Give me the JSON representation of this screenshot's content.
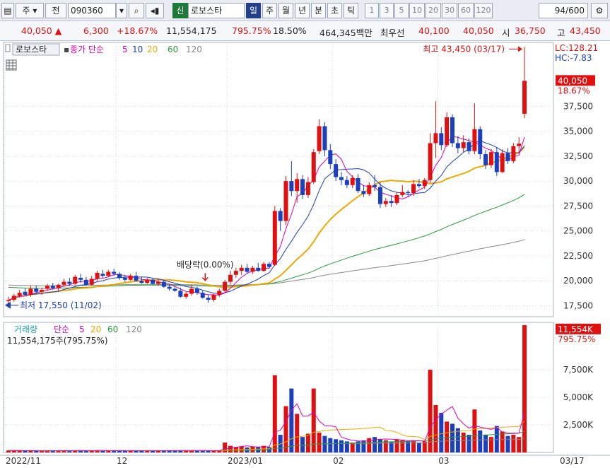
{
  "toolbar": {
    "market": "주",
    "type": "전",
    "code": "090360",
    "market_tag": "신",
    "name": "로보스타",
    "periods": [
      "일",
      "주",
      "월",
      "년",
      "분",
      "초",
      "틱"
    ],
    "active_period": "일",
    "intervals": [
      "1",
      "3",
      "5",
      "10",
      "20",
      "30",
      "60",
      "120"
    ],
    "count": "94/600"
  },
  "info": {
    "price": "40,050",
    "change": "6,300",
    "change_pct": "+18.67%",
    "volume": "11,554,175",
    "volume_ratio": "795.75%",
    "turnover": "18.50%",
    "amount": "464,345백만",
    "best_ask_label": "최우선",
    "best_ask": "40,100",
    "best_bid": "40,050",
    "open_label": "시",
    "open": "36,750",
    "high_label": "고",
    "high": "43,450"
  },
  "colors": {
    "up": "#e01010",
    "down": "#1a3fbf",
    "ma5": "#e000b0",
    "ma10": "#1a3fbf",
    "ma20": "#f0a800",
    "ma60": "#2a9a3a",
    "ma120": "#888888"
  },
  "chart_data": {
    "type": "candlestick",
    "price_panel": {
      "legend": {
        "name": "로보스타",
        "label": "종가 단순",
        "periods": [
          "5",
          "10",
          "20",
          "60",
          "120"
        ]
      },
      "y_ticks": [
        "17,500",
        "20,000",
        "22,500",
        "25,000",
        "27,500",
        "30,000",
        "32,500",
        "35,000",
        "37,500"
      ],
      "ylim": [
        16400,
        43900
      ],
      "lc": "LC:128.21",
      "hc": "HC:-7.83",
      "last_price": "40,050",
      "last_change": "18.67%",
      "high_annotation": "최고 43,450 (03/17)",
      "low_annotation": "최저 17,550 (11/02)",
      "dividend_annotation": "배당락(0.00%)",
      "candles": [
        {
          "o": 17950,
          "h": 18400,
          "l": 17550,
          "c": 18050
        },
        {
          "o": 18100,
          "h": 18700,
          "l": 17900,
          "c": 18500
        },
        {
          "o": 18500,
          "h": 19100,
          "l": 18300,
          "c": 18800
        },
        {
          "o": 18900,
          "h": 19300,
          "l": 18500,
          "c": 18600
        },
        {
          "o": 18600,
          "h": 19500,
          "l": 18400,
          "c": 19200
        },
        {
          "o": 19200,
          "h": 19500,
          "l": 18700,
          "c": 18900
        },
        {
          "o": 18900,
          "h": 19300,
          "l": 18600,
          "c": 19100
        },
        {
          "o": 19200,
          "h": 19700,
          "l": 19000,
          "c": 19500
        },
        {
          "o": 19500,
          "h": 19800,
          "l": 19100,
          "c": 19300
        },
        {
          "o": 19300,
          "h": 19700,
          "l": 18900,
          "c": 19600
        },
        {
          "o": 19600,
          "h": 20200,
          "l": 19400,
          "c": 19900
        },
        {
          "o": 19900,
          "h": 20300,
          "l": 19500,
          "c": 19700
        },
        {
          "o": 19700,
          "h": 20600,
          "l": 19600,
          "c": 20400
        },
        {
          "o": 20300,
          "h": 20700,
          "l": 19800,
          "c": 20100
        },
        {
          "o": 20100,
          "h": 20400,
          "l": 19500,
          "c": 19600
        },
        {
          "o": 19600,
          "h": 20500,
          "l": 19500,
          "c": 20200
        },
        {
          "o": 20200,
          "h": 21000,
          "l": 20000,
          "c": 20800
        },
        {
          "o": 20700,
          "h": 21100,
          "l": 20300,
          "c": 20500
        },
        {
          "o": 20500,
          "h": 21100,
          "l": 20400,
          "c": 20900
        },
        {
          "o": 20900,
          "h": 21200,
          "l": 20500,
          "c": 20700
        },
        {
          "o": 20700,
          "h": 20900,
          "l": 20100,
          "c": 20300
        },
        {
          "o": 20300,
          "h": 20600,
          "l": 19900,
          "c": 20100
        },
        {
          "o": 20100,
          "h": 20700,
          "l": 20000,
          "c": 20500
        },
        {
          "o": 20500,
          "h": 20900,
          "l": 19900,
          "c": 20000
        },
        {
          "o": 20000,
          "h": 20400,
          "l": 19700,
          "c": 19800
        },
        {
          "o": 19800,
          "h": 20300,
          "l": 19700,
          "c": 20100
        },
        {
          "o": 20100,
          "h": 20300,
          "l": 19600,
          "c": 19700
        },
        {
          "o": 19700,
          "h": 20200,
          "l": 19500,
          "c": 19900
        },
        {
          "o": 19900,
          "h": 20100,
          "l": 19300,
          "c": 19400
        },
        {
          "o": 19400,
          "h": 19700,
          "l": 19000,
          "c": 19200
        },
        {
          "o": 19200,
          "h": 19500,
          "l": 18900,
          "c": 19000
        },
        {
          "o": 19000,
          "h": 19300,
          "l": 18300,
          "c": 18400
        },
        {
          "o": 18400,
          "h": 18900,
          "l": 18200,
          "c": 18700
        },
        {
          "o": 18700,
          "h": 19600,
          "l": 18500,
          "c": 19200
        },
        {
          "o": 19200,
          "h": 19400,
          "l": 18600,
          "c": 18800
        },
        {
          "o": 18800,
          "h": 19000,
          "l": 18200,
          "c": 18300
        },
        {
          "o": 18300,
          "h": 18600,
          "l": 17800,
          "c": 18100
        },
        {
          "o": 18100,
          "h": 18700,
          "l": 17900,
          "c": 18600
        },
        {
          "o": 18600,
          "h": 19200,
          "l": 18400,
          "c": 19000
        },
        {
          "o": 19000,
          "h": 20100,
          "l": 18800,
          "c": 19900
        },
        {
          "o": 19900,
          "h": 21000,
          "l": 19600,
          "c": 20600
        },
        {
          "o": 20600,
          "h": 21300,
          "l": 20300,
          "c": 21000
        },
        {
          "o": 21000,
          "h": 21600,
          "l": 20600,
          "c": 21300
        },
        {
          "o": 21300,
          "h": 21700,
          "l": 20700,
          "c": 20900
        },
        {
          "o": 20900,
          "h": 21500,
          "l": 20700,
          "c": 21300
        },
        {
          "o": 21300,
          "h": 21800,
          "l": 20900,
          "c": 21000
        },
        {
          "o": 21000,
          "h": 21900,
          "l": 20900,
          "c": 21700
        },
        {
          "o": 21700,
          "h": 21900,
          "l": 21200,
          "c": 21400
        },
        {
          "o": 21600,
          "h": 27500,
          "l": 21500,
          "c": 27000
        },
        {
          "o": 27000,
          "h": 27300,
          "l": 25000,
          "c": 26000
        },
        {
          "o": 26000,
          "h": 30500,
          "l": 25600,
          "c": 30000
        },
        {
          "o": 30000,
          "h": 32000,
          "l": 28500,
          "c": 29000
        },
        {
          "o": 29000,
          "h": 30800,
          "l": 27800,
          "c": 30200
        },
        {
          "o": 30200,
          "h": 30600,
          "l": 28200,
          "c": 28600
        },
        {
          "o": 28600,
          "h": 30400,
          "l": 28300,
          "c": 29900
        },
        {
          "o": 29900,
          "h": 33200,
          "l": 29700,
          "c": 32900
        },
        {
          "o": 33000,
          "h": 36200,
          "l": 32700,
          "c": 35500
        },
        {
          "o": 35500,
          "h": 35900,
          "l": 32500,
          "c": 33100
        },
        {
          "o": 33100,
          "h": 33700,
          "l": 31200,
          "c": 31700
        },
        {
          "o": 31700,
          "h": 32200,
          "l": 30000,
          "c": 30400
        },
        {
          "o": 30400,
          "h": 30900,
          "l": 29600,
          "c": 30100
        },
        {
          "o": 30100,
          "h": 30500,
          "l": 29300,
          "c": 29600
        },
        {
          "o": 29600,
          "h": 30600,
          "l": 29300,
          "c": 30300
        },
        {
          "o": 30300,
          "h": 30700,
          "l": 28800,
          "c": 29000
        },
        {
          "o": 29000,
          "h": 29600,
          "l": 28400,
          "c": 28700
        },
        {
          "o": 28700,
          "h": 29900,
          "l": 28500,
          "c": 29600
        },
        {
          "o": 29600,
          "h": 30600,
          "l": 29000,
          "c": 29400
        },
        {
          "o": 29400,
          "h": 29900,
          "l": 27300,
          "c": 27700
        },
        {
          "o": 27700,
          "h": 28300,
          "l": 27400,
          "c": 28000
        },
        {
          "o": 28000,
          "h": 28600,
          "l": 27400,
          "c": 27800
        },
        {
          "o": 27800,
          "h": 28900,
          "l": 27600,
          "c": 28600
        },
        {
          "o": 28600,
          "h": 29600,
          "l": 28400,
          "c": 28900
        },
        {
          "o": 28900,
          "h": 29100,
          "l": 28400,
          "c": 28800
        },
        {
          "o": 28800,
          "h": 30100,
          "l": 28500,
          "c": 29700
        },
        {
          "o": 29700,
          "h": 30200,
          "l": 29300,
          "c": 29500
        },
        {
          "o": 29500,
          "h": 30300,
          "l": 29200,
          "c": 30100
        },
        {
          "o": 30100,
          "h": 34800,
          "l": 29800,
          "c": 33800
        },
        {
          "o": 33800,
          "h": 38000,
          "l": 32300,
          "c": 34800
        },
        {
          "o": 34800,
          "h": 35400,
          "l": 33100,
          "c": 33600
        },
        {
          "o": 33600,
          "h": 36900,
          "l": 33400,
          "c": 36400
        },
        {
          "o": 36400,
          "h": 36700,
          "l": 33400,
          "c": 33800
        },
        {
          "o": 33800,
          "h": 34500,
          "l": 32800,
          "c": 33300
        },
        {
          "o": 33300,
          "h": 34600,
          "l": 32900,
          "c": 33900
        },
        {
          "o": 33900,
          "h": 34300,
          "l": 32700,
          "c": 33000
        },
        {
          "o": 33000,
          "h": 37800,
          "l": 32700,
          "c": 35200
        },
        {
          "o": 35200,
          "h": 35500,
          "l": 32200,
          "c": 32700
        },
        {
          "o": 32700,
          "h": 33100,
          "l": 31200,
          "c": 31600
        },
        {
          "o": 31600,
          "h": 33200,
          "l": 31300,
          "c": 32900
        },
        {
          "o": 32900,
          "h": 33400,
          "l": 30500,
          "c": 30900
        },
        {
          "o": 30900,
          "h": 33200,
          "l": 30800,
          "c": 32800
        },
        {
          "o": 32800,
          "h": 33300,
          "l": 31700,
          "c": 32000
        },
        {
          "o": 32000,
          "h": 33800,
          "l": 31800,
          "c": 33500
        },
        {
          "o": 33500,
          "h": 34400,
          "l": 32800,
          "c": 33750
        },
        {
          "o": 36750,
          "h": 43450,
          "l": 36300,
          "c": 40050
        }
      ]
    },
    "volume_panel": {
      "legend": {
        "label": "거래량",
        "method": "단순",
        "periods": [
          "5",
          "20",
          "60",
          "120"
        ]
      },
      "subtitle": "11,554,175주(795.75%)",
      "y_ticks": [
        "2,500K",
        "5,000K",
        "7,500K"
      ],
      "ylim": [
        0,
        11800
      ],
      "last_volume": "11,554K",
      "last_ratio": "795.75%",
      "values": [
        180,
        150,
        170,
        140,
        160,
        150,
        130,
        170,
        150,
        160,
        180,
        140,
        190,
        170,
        160,
        150,
        200,
        170,
        160,
        150,
        140,
        160,
        150,
        170,
        140,
        150,
        160,
        150,
        170,
        160,
        150,
        200,
        170,
        180,
        160,
        150,
        170,
        160,
        180,
        900,
        600,
        500,
        550,
        450,
        520,
        480,
        600,
        500,
        7000,
        1600,
        4200,
        5800,
        3500,
        1400,
        1700,
        5800,
        1800,
        1500,
        1300,
        1200,
        1100,
        1000,
        900,
        1000,
        1100,
        1300,
        1400,
        1200,
        1100,
        1000,
        1200,
        1100,
        1000,
        1100,
        900,
        1000,
        7500,
        4300,
        3600,
        2800,
        2600,
        2200,
        1800,
        1600,
        3900,
        2000,
        1600,
        1400,
        2400,
        1900,
        1500,
        1600,
        1400,
        11554
      ]
    },
    "x_ticks": [
      {
        "label": "2022/11",
        "index": 0
      },
      {
        "label": "12",
        "index": 20
      },
      {
        "label": "2023/01",
        "index": 40
      },
      {
        "label": "02",
        "index": 59
      },
      {
        "label": "03",
        "index": 78
      },
      {
        "label": "03/17",
        "index": 93
      }
    ],
    "x_tick_bold": [
      "2022/11",
      "2023/01"
    ],
    "x_tick_edge": "03/17",
    "dividend_index": 38,
    "grid": true
  }
}
